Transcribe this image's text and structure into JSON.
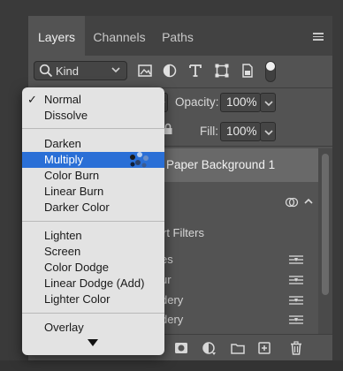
{
  "tabs": [
    {
      "label": "Layers",
      "active": true
    },
    {
      "label": "Channels",
      "active": false
    },
    {
      "label": "Paths",
      "active": false
    }
  ],
  "filter": {
    "kind_label": "Kind",
    "icons": [
      "image-filter-icon",
      "adjustment-filter-icon",
      "type-filter-icon",
      "shape-filter-icon",
      "smart-object-filter-icon"
    ],
    "toggle_on": true
  },
  "opacity": {
    "label": "Opacity:",
    "value": "100%"
  },
  "fill": {
    "label": "Fill:",
    "value": "100%"
  },
  "layer": {
    "name": "Paper Background 1"
  },
  "smart_filters_label": "rt Filters",
  "filter_items": [
    "es",
    "ur",
    "dery",
    "dery"
  ],
  "toolbar_icons": [
    "mask-icon",
    "adjustment-layer-icon",
    "group-folder-icon",
    "new-layer-icon",
    "trash-icon"
  ],
  "blend_menu": {
    "groups": [
      [
        "Normal",
        "Dissolve"
      ],
      [
        "Darken",
        "Multiply",
        "Color Burn",
        "Linear Burn",
        "Darker Color"
      ],
      [
        "Lighten",
        "Screen",
        "Color Dodge",
        "Linear Dodge (Add)",
        "Lighter Color"
      ],
      [
        "Overlay"
      ]
    ],
    "checked": "Normal",
    "highlighted": "Multiply"
  },
  "colors": {
    "panel_bg": "#535353",
    "menu_bg": "#e3e3e3",
    "highlight": "#2a6fd6",
    "layer_row": "#696969"
  }
}
